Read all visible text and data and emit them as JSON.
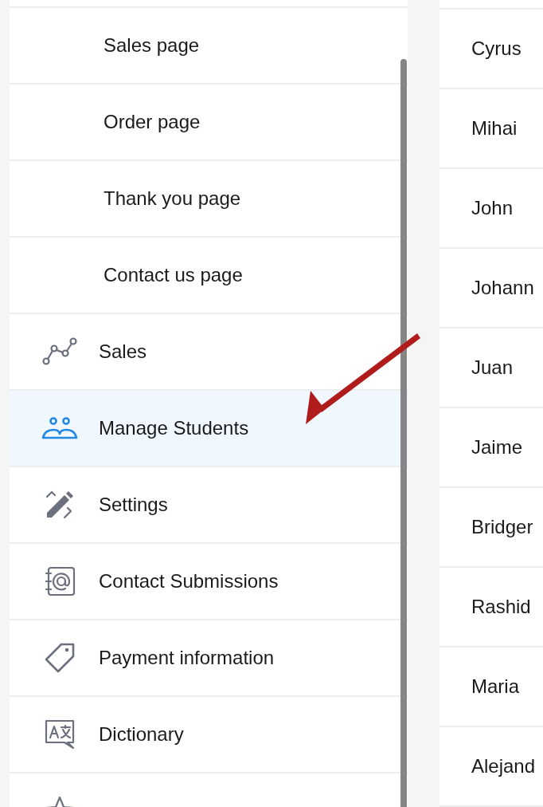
{
  "sidebar": {
    "items": [
      {
        "kind": "subpage",
        "label": "Sales page",
        "selected": false
      },
      {
        "kind": "subpage",
        "label": "Order page",
        "selected": false
      },
      {
        "kind": "subpage",
        "label": "Thank you page",
        "selected": false
      },
      {
        "kind": "subpage",
        "label": "Contact us page",
        "selected": false
      },
      {
        "kind": "section",
        "label": "Sales",
        "selected": false
      },
      {
        "kind": "section",
        "label": "Manage Students",
        "selected": true
      },
      {
        "kind": "section",
        "label": "Settings",
        "selected": false
      },
      {
        "kind": "section",
        "label": "Contact Submissions",
        "selected": false
      },
      {
        "kind": "section",
        "label": "Payment information",
        "selected": false
      },
      {
        "kind": "section",
        "label": "Dictionary",
        "selected": false
      },
      {
        "kind": "section",
        "selected": false
      }
    ]
  },
  "students": {
    "names": [
      "Cyrus",
      "Mihai",
      "John",
      "Johann",
      "Juan",
      "Jaime",
      "Bridger",
      "Rashid",
      "Maria",
      "Alejand"
    ]
  }
}
